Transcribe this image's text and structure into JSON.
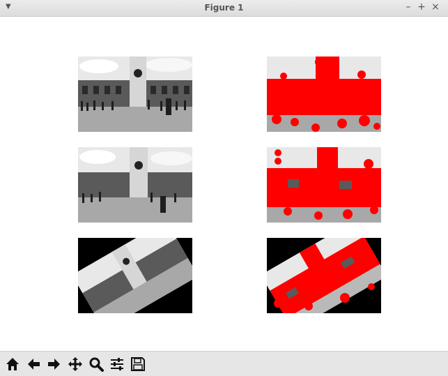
{
  "window": {
    "title": "Figure 1",
    "controls": [
      "minimize",
      "maximize",
      "close"
    ]
  },
  "figure": {
    "layout": "3x2 grid of image axes",
    "panels": [
      {
        "name": "original-image",
        "marker_overlay": false
      },
      {
        "name": "original-keypoints",
        "marker_overlay": true,
        "marker_color": "#ff0000"
      },
      {
        "name": "scaled-image",
        "marker_overlay": false
      },
      {
        "name": "scaled-keypoints",
        "marker_overlay": true,
        "marker_color": "#ff0000"
      },
      {
        "name": "rotated-image",
        "marker_overlay": false
      },
      {
        "name": "rotated-keypoints",
        "marker_overlay": true,
        "marker_color": "#ff0000"
      }
    ]
  },
  "toolbar": {
    "buttons": [
      {
        "name": "home",
        "icon": "home-icon"
      },
      {
        "name": "back",
        "icon": "arrow-left-icon"
      },
      {
        "name": "forward",
        "icon": "arrow-right-icon"
      },
      {
        "name": "pan",
        "icon": "move-icon"
      },
      {
        "name": "zoom",
        "icon": "zoom-icon"
      },
      {
        "name": "configure-subplots",
        "icon": "sliders-icon"
      },
      {
        "name": "save",
        "icon": "save-icon"
      }
    ]
  }
}
